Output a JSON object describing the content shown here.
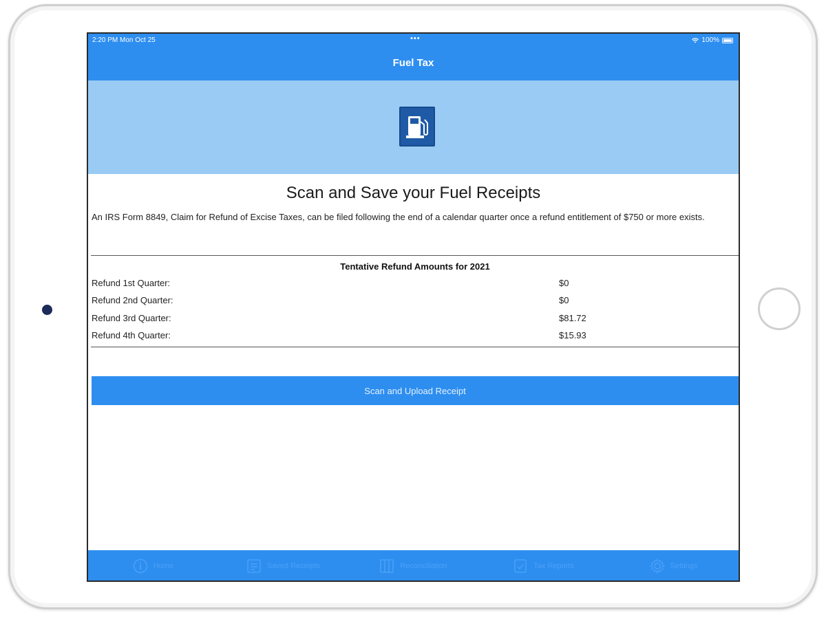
{
  "status_bar": {
    "time_date": "2:20 PM   Mon Oct 25",
    "dots": "•••",
    "battery": "100%"
  },
  "nav": {
    "title": "Fuel Tax"
  },
  "hero": {
    "logo_icon": "fuel-pump-icon"
  },
  "main": {
    "headline": "Scan and Save your Fuel Receipts",
    "description": "An IRS Form 8849, Claim for Refund of Excise Taxes, can be filed following the end of a calendar quarter once a refund entitlement of $750 or more exists."
  },
  "refunds": {
    "heading": "Tentative Refund Amounts for 2021",
    "rows": [
      {
        "label": "Refund 1st Quarter:",
        "value": "$0"
      },
      {
        "label": "Refund 2nd Quarter:",
        "value": "$0"
      },
      {
        "label": "Refund 3rd Quarter:",
        "value": "$81.72"
      },
      {
        "label": "Refund 4th Quarter:",
        "value": "$15.93"
      }
    ]
  },
  "actions": {
    "upload_label": "Scan and Upload Receipt"
  },
  "tabs": [
    {
      "label": "Home",
      "icon": "info-icon"
    },
    {
      "label": "Saved Receipts",
      "icon": "receipt-icon"
    },
    {
      "label": "Reconciliation",
      "icon": "columns-icon"
    },
    {
      "label": "Tax Reports",
      "icon": "report-icon"
    },
    {
      "label": "Settings",
      "icon": "gear-icon"
    }
  ],
  "colors": {
    "primary": "#2d8ef0",
    "hero_background": "#99cbf4",
    "logo_background": "#1f5aa6"
  }
}
